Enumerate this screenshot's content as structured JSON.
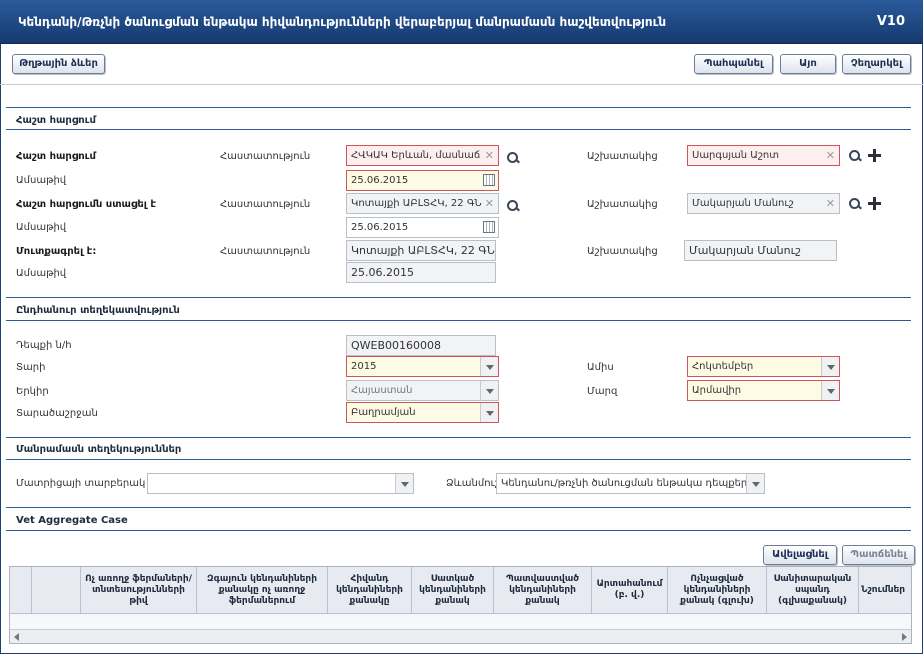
{
  "window": {
    "title": "Կենդանի/Թռչնի ծանուցման ենթակա հիվանդությունների վերաբերյալ մանրամասն հաշվետվություն",
    "version": "V10"
  },
  "toolbar": {
    "history_label": "Թղթային ձևեր",
    "print_label": "Պահպանել",
    "ok_label": "Այո",
    "cancel_label": "Չեղարկել"
  },
  "report_section": {
    "title": "Հաշտ հարցում",
    "rows": {
      "received_by": {
        "label": "Հաշտ հարցում",
        "org_label": "Հաստատություն",
        "org_value": "ՀՎԿԱԿ Երևան, մասնաճ",
        "employee_label": "Աշխատակից",
        "employee_value": "Սարգսյան Աշոտ",
        "date_label": "Ամսաթիվ",
        "date_value": "25.06.2015"
      },
      "sent_by": {
        "label": "Հաշտ հարցումն ստացել է",
        "org_label": "Հաստատություն",
        "org_value": "Կոտայքի ԱԲԼՏՀԿ, 22 ԳՆ",
        "employee_label": "Աշխատակից",
        "employee_value": "Մակարյան Մանուշ",
        "date_label": "Ամսաթիվ",
        "date_value": "25.06.2015"
      },
      "entered_by": {
        "label": "Մուտքագրել է:",
        "org_label": "Հաստատություն",
        "org_value": "Կոտայքի ԱԲԼՏՀԿ, 22 ԳՆ",
        "employee_label": "Աշխատակից",
        "employee_value": "Մակարյան Մանուշ",
        "date_label": "Ամսաթիվ",
        "date_value": "25.06.2015"
      }
    }
  },
  "general_section": {
    "title": "Ընդհանուր տեղեկատվություն",
    "case_id_label": "Դեպքի ն/հ",
    "case_id_value": "QWEB00160008",
    "year_label": "Տարի",
    "year_value": "2015",
    "month_label": "Ամիս",
    "month_value": "Հոկտեմբեր",
    "country_label": "Երկիր",
    "country_value": "Հայաստան",
    "region_label": "Մարզ",
    "region_value": "Արմավիր",
    "settlement_label": "Տարածաշրջան",
    "settlement_value": "Բաղրամյան"
  },
  "detail_section": {
    "title": "Մանրամասն տեղեկություններ",
    "matrix_label": "Մատրիցայի տարբերակ",
    "matrix_value": "",
    "template_label": "Ձևանմուշ",
    "template_value": "Կենդանու/թռչնի ծանուցման ենթակա դեպքեր"
  },
  "aggregate_section": {
    "title": "Vet Aggregate Case",
    "copy_label": "Ավելացնել",
    "delete_label": "Պատճենել",
    "columns": [
      "",
      "",
      "Ոչ առողջ ֆերմաների/ տնտեսությունների թիվ",
      "Զգայուն կենդանիների քանակը ոչ առողջ ֆերմաներում",
      "Հիվանդ կենդանիների քանակը",
      "Սատկած կենդանիների քանակ",
      "Պատվաստված կենդանիների քանակ",
      "Արտահանում (բ. վ.)",
      "Ոչնչացված կենդանիների քանակ (գլուխ)",
      "Սանիտարական սպանդ (գլխաքանակ)",
      "Նշումներ"
    ]
  }
}
